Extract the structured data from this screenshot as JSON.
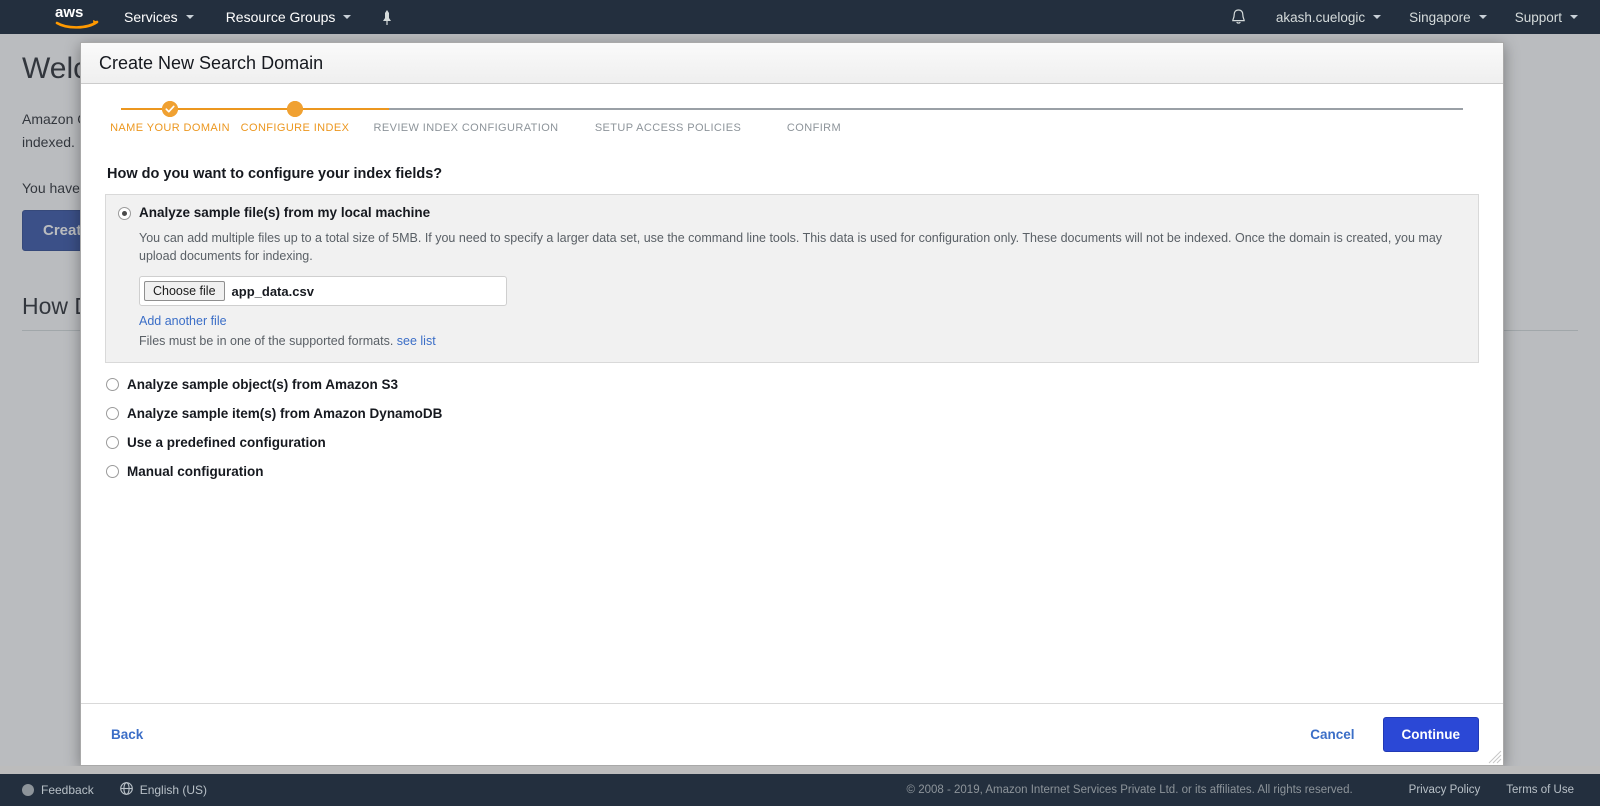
{
  "topnav": {
    "logo": "aws-logo",
    "services": "Services",
    "resource_groups": "Resource Groups",
    "pin_icon": "pin-icon",
    "bell_icon": "bell-icon",
    "account": "akash.cuelogic",
    "region": "Singapore",
    "support": "Support"
  },
  "background_page": {
    "heading": "Welcome to Amazon CloudSearch",
    "paragraph": "Amazon CloudSearch makes it easy to set up, manage, and scale a search solution for your website or application. You start by submitting your data to be indexed.",
    "domains_line": "You have no search domains.",
    "create_button": "Create a new search domain",
    "section_heading": "How Does It Work?"
  },
  "modal": {
    "title": "Create New Search Domain",
    "steps": [
      {
        "label": "NAME YOUR DOMAIN",
        "state": "done"
      },
      {
        "label": "CONFIGURE INDEX",
        "state": "active"
      },
      {
        "label": "REVIEW INDEX CONFIGURATION",
        "state": "todo"
      },
      {
        "label": "SETUP ACCESS POLICIES",
        "state": "todo"
      },
      {
        "label": "CONFIRM",
        "state": "todo"
      }
    ],
    "question": "How do you want to configure your index fields?",
    "selected_option": "Analyze sample file(s) from my local machine",
    "selected_description": "You can add multiple files up to a total size of 5MB. If you need to specify a larger data set, use the command line tools. This data is used for configuration only. These documents will not be indexed. Once the domain is created, you may upload documents for indexing.",
    "choose_file_button": "Choose file",
    "chosen_file_name": "app_data.csv",
    "add_another_file": "Add another file",
    "formats_text": "Files must be in one of the supported formats.",
    "formats_link": "see list",
    "other_options": [
      "Analyze sample object(s) from Amazon S3",
      "Analyze sample item(s) from Amazon DynamoDB",
      "Use a predefined configuration",
      "Manual configuration"
    ],
    "back_button": "Back",
    "cancel_button": "Cancel",
    "continue_button": "Continue"
  },
  "bottom_bar": {
    "feedback": "Feedback",
    "language": "English (US)",
    "copyright": "© 2008 - 2019, Amazon Internet Services Private Ltd. or its affiliates. All rights reserved.",
    "privacy_policy": "Privacy Policy",
    "terms_of_use": "Terms of Use"
  },
  "colors": {
    "nav_bg": "#232f3e",
    "accent_orange": "#ec971f",
    "primary_blue": "#2b48d6",
    "link_blue": "#3b6ec7"
  }
}
